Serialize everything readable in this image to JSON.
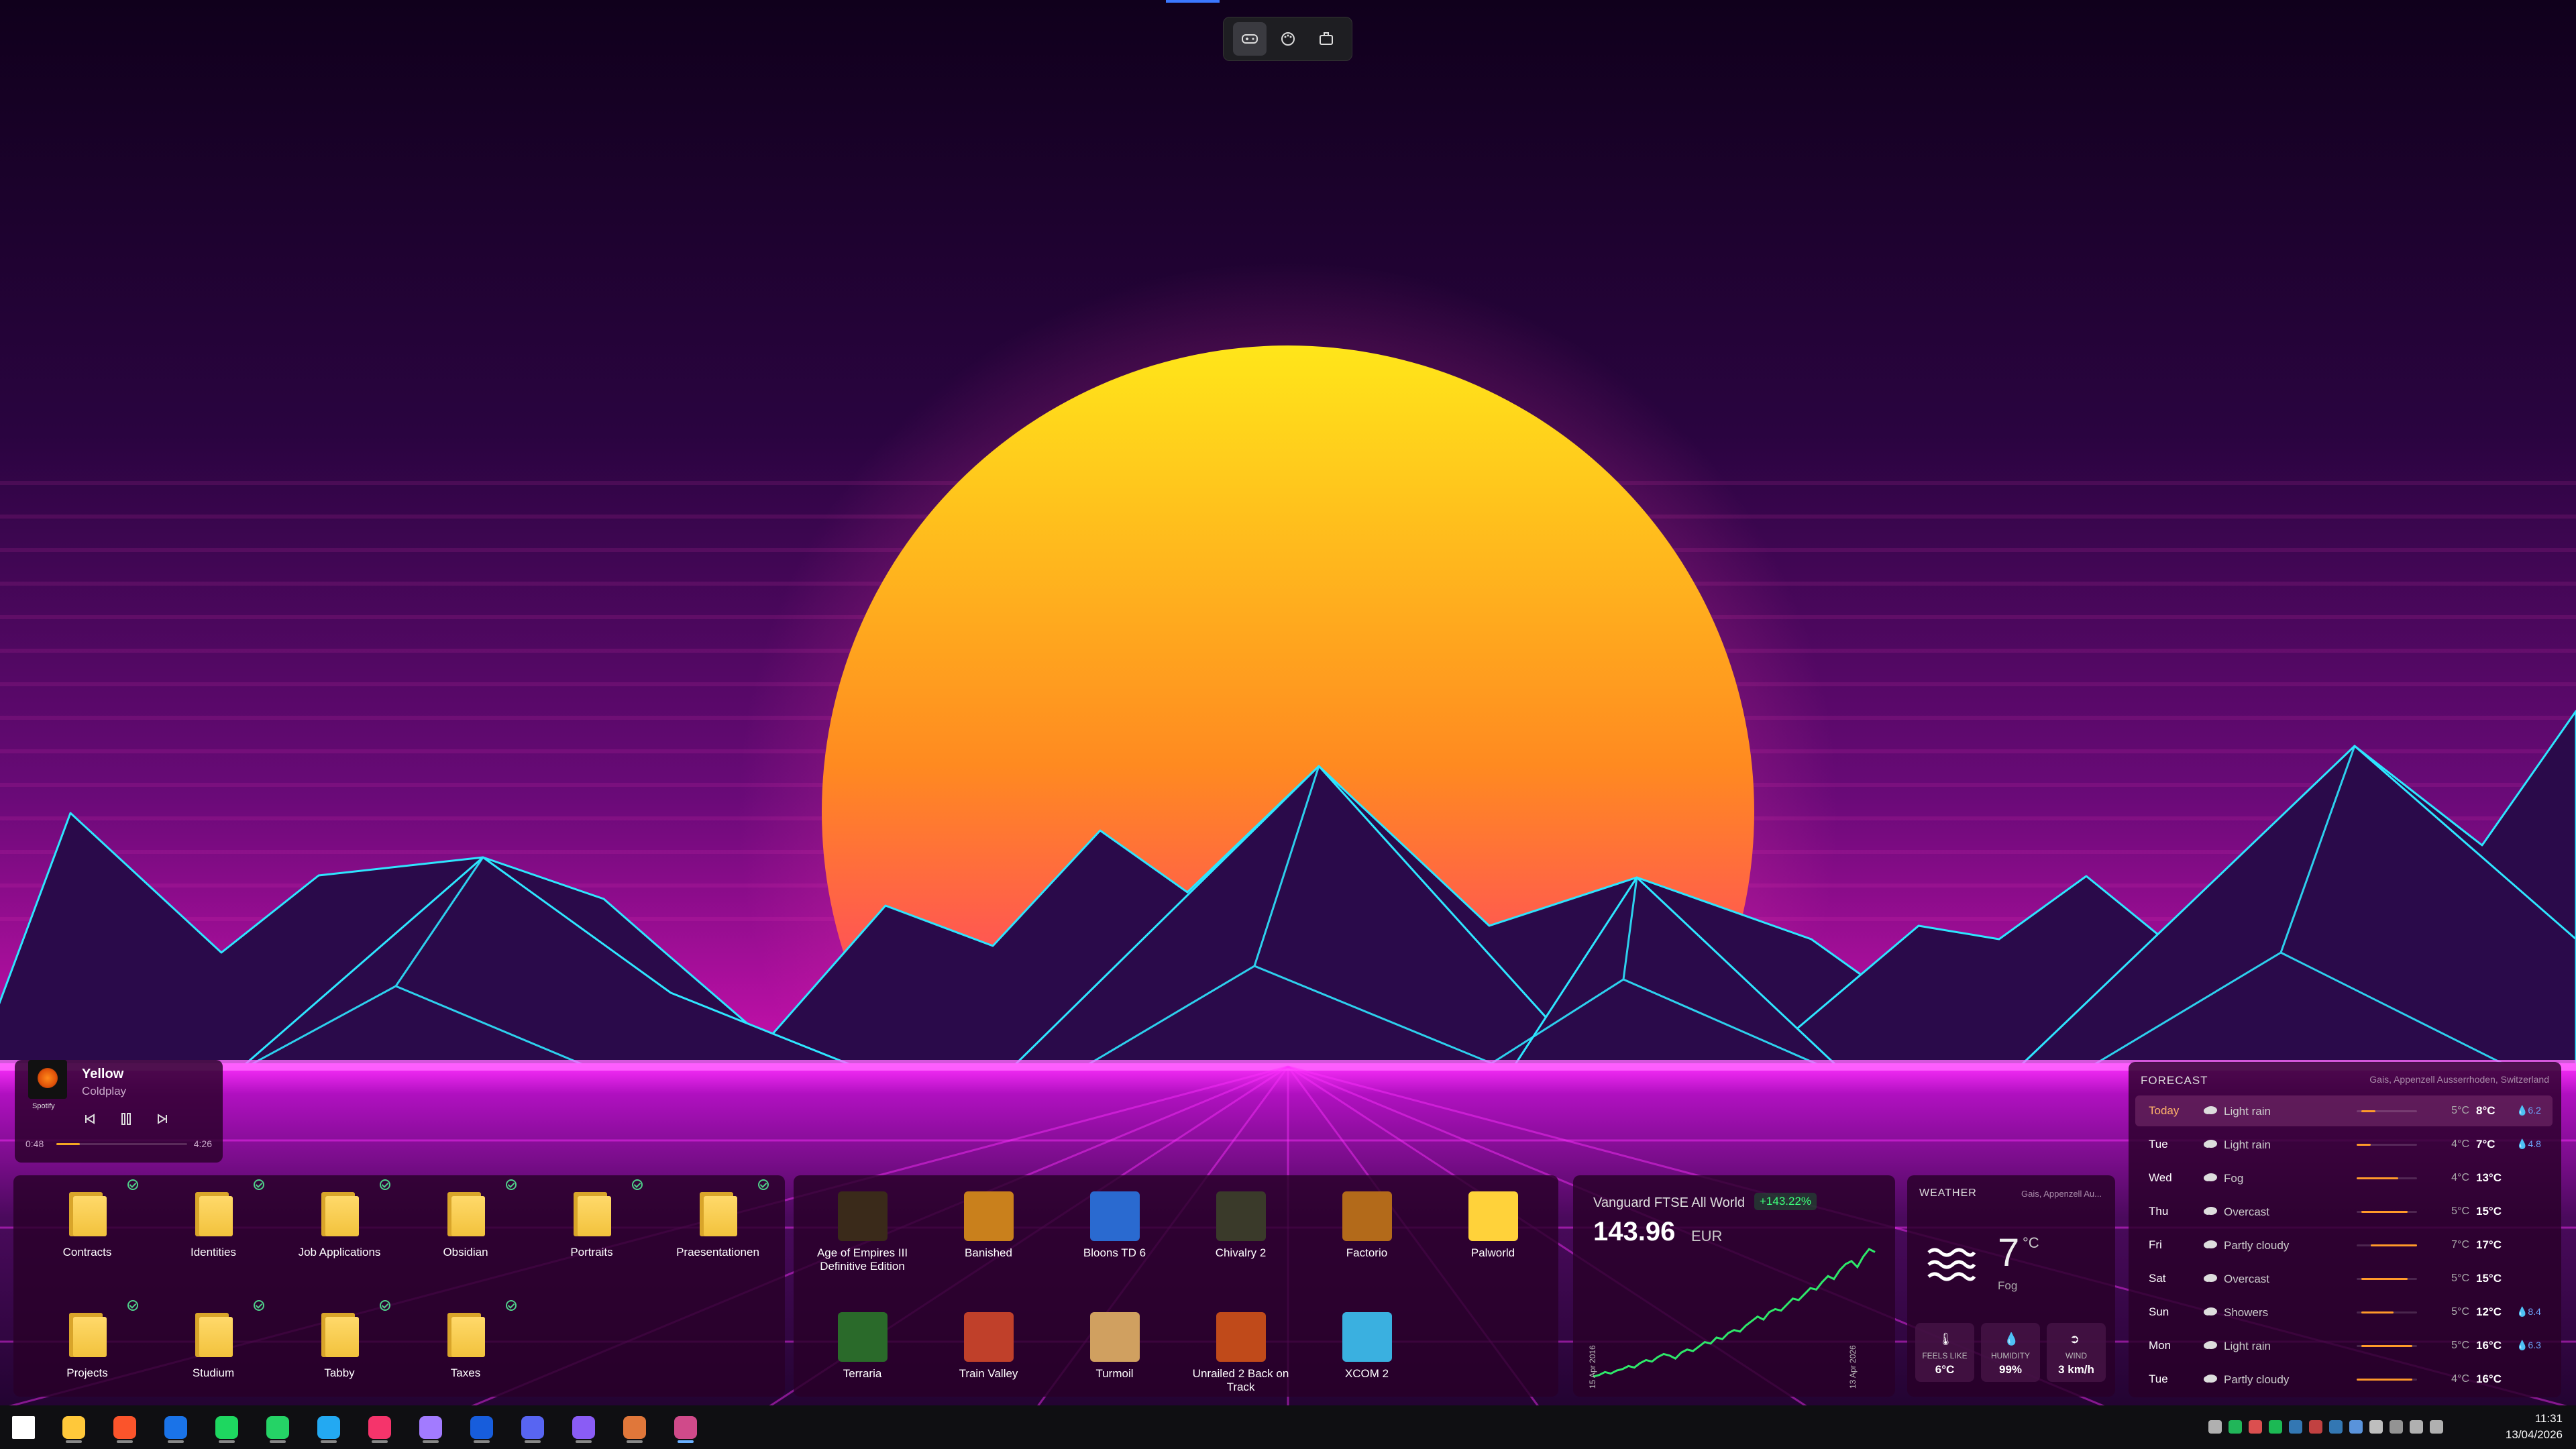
{
  "toolbar": {
    "buttons": [
      {
        "name": "games-tab-icon",
        "active": true
      },
      {
        "name": "palette-icon",
        "active": false
      },
      {
        "name": "briefcase-icon",
        "active": false
      }
    ]
  },
  "media": {
    "title": "Yellow",
    "artist": "Coldplay",
    "source": "Spotify",
    "elapsed": "0:48",
    "duration": "4:26",
    "progress": 0.18
  },
  "folders": [
    {
      "label": "Contracts",
      "synced": true
    },
    {
      "label": "Identities",
      "synced": true
    },
    {
      "label": "Job Applications",
      "synced": true
    },
    {
      "label": "Obsidian",
      "synced": true
    },
    {
      "label": "Portraits",
      "synced": true
    },
    {
      "label": "Praesentationen",
      "synced": true
    },
    {
      "label": "Projects",
      "synced": true
    },
    {
      "label": "Studium",
      "synced": true
    },
    {
      "label": "Tabby",
      "synced": true
    },
    {
      "label": "Taxes",
      "synced": true
    }
  ],
  "games": [
    {
      "label": "Age of Empires III Definitive Edition",
      "icon": "aoe-icon",
      "color": "#3a2a1a"
    },
    {
      "label": "Banished",
      "icon": "banished-icon",
      "color": "#c9801c"
    },
    {
      "label": "Bloons TD 6",
      "icon": "bloons-icon",
      "color": "#2a6ad0"
    },
    {
      "label": "Chivalry 2",
      "icon": "chivalry-icon",
      "color": "#3a3a2a"
    },
    {
      "label": "Factorio",
      "icon": "factorio-icon",
      "color": "#b36a1a"
    },
    {
      "label": "Palworld",
      "icon": "palworld-icon",
      "color": "#ffd23a"
    },
    {
      "label": "Terraria",
      "icon": "terraria-icon",
      "color": "#2a6a2a"
    },
    {
      "label": "Train Valley",
      "icon": "train-valley-icon",
      "color": "#c0402a"
    },
    {
      "label": "Turmoil",
      "icon": "turmoil-icon",
      "color": "#d0a060"
    },
    {
      "label": "Unrailed 2 Back on Track",
      "icon": "unrailed-icon",
      "color": "#c04a1a"
    },
    {
      "label": "XCOM 2",
      "icon": "xcom-icon",
      "color": "#3ab0e0"
    }
  ],
  "stock": {
    "name": "Vanguard FTSE All World",
    "change": "+143.22%",
    "price": "143.96",
    "currency": "EUR",
    "date_start": "15 Apr 2016",
    "date_end": "13 Apr 2026",
    "series": [
      15,
      16,
      18,
      17,
      19,
      20,
      22,
      21,
      24,
      26,
      25,
      28,
      30,
      29,
      27,
      31,
      33,
      32,
      35,
      38,
      37,
      41,
      40,
      44,
      46,
      45,
      49,
      52,
      55,
      53,
      58,
      60,
      59,
      63,
      67,
      66,
      70,
      74,
      73,
      78,
      82,
      80,
      86,
      90,
      92,
      88,
      95,
      100,
      98
    ]
  },
  "weather": {
    "header": "WEATHER",
    "location": "Gais, Appenzell Au...",
    "temp": "7",
    "unit": "°C",
    "condition": "Fog",
    "feels_label": "FEELS LIKE",
    "feels": "6°C",
    "humidity_label": "HUMIDITY",
    "humidity": "99%",
    "wind_label": "WIND",
    "wind": "3 km/h"
  },
  "forecast": {
    "header": "FORECAST",
    "location": "Gais, Appenzell Ausserrhoden, Switzerland",
    "days": [
      {
        "day": "Today",
        "cond": "Light rain",
        "lo": "5°C",
        "hi": "8°C",
        "precip": "6.2",
        "lo_n": 5,
        "hi_n": 8
      },
      {
        "day": "Tue",
        "cond": "Light rain",
        "lo": "4°C",
        "hi": "7°C",
        "precip": "4.8",
        "lo_n": 4,
        "hi_n": 7
      },
      {
        "day": "Wed",
        "cond": "Fog",
        "lo": "4°C",
        "hi": "13°C",
        "precip": "",
        "lo_n": 4,
        "hi_n": 13
      },
      {
        "day": "Thu",
        "cond": "Overcast",
        "lo": "5°C",
        "hi": "15°C",
        "precip": "",
        "lo_n": 5,
        "hi_n": 15
      },
      {
        "day": "Fri",
        "cond": "Partly cloudy",
        "lo": "7°C",
        "hi": "17°C",
        "precip": "",
        "lo_n": 7,
        "hi_n": 17
      },
      {
        "day": "Sat",
        "cond": "Overcast",
        "lo": "5°C",
        "hi": "15°C",
        "precip": "",
        "lo_n": 5,
        "hi_n": 15
      },
      {
        "day": "Sun",
        "cond": "Showers",
        "lo": "5°C",
        "hi": "12°C",
        "precip": "8.4",
        "lo_n": 5,
        "hi_n": 12
      },
      {
        "day": "Mon",
        "cond": "Light rain",
        "lo": "5°C",
        "hi": "16°C",
        "precip": "6.3",
        "lo_n": 5,
        "hi_n": 16
      },
      {
        "day": "Tue",
        "cond": "Partly cloudy",
        "lo": "4°C",
        "hi": "16°C",
        "precip": "",
        "lo_n": 4,
        "hi_n": 16
      }
    ]
  },
  "taskbar": {
    "apps": [
      {
        "name": "start-icon",
        "color": "#ffffff"
      },
      {
        "name": "file-explorer-icon",
        "color": "#ffc83a"
      },
      {
        "name": "brave-icon",
        "color": "#fb542b"
      },
      {
        "name": "outlook-icon",
        "color": "#1a73e8"
      },
      {
        "name": "spotify-icon",
        "color": "#1ed760"
      },
      {
        "name": "whatsapp-icon",
        "color": "#25d366"
      },
      {
        "name": "vscode-icon",
        "color": "#23a9f2"
      },
      {
        "name": "jetbrains-icon",
        "color": "#f5346b"
      },
      {
        "name": "github-icon",
        "color": "#a27bff"
      },
      {
        "name": "bitwarden-icon",
        "color": "#175ddc"
      },
      {
        "name": "discord-icon",
        "color": "#5865f2"
      },
      {
        "name": "obsidian-icon",
        "color": "#8a5cf5"
      },
      {
        "name": "claude-icon",
        "color": "#e0773a"
      },
      {
        "name": "app-icon",
        "color": "#d04a8a"
      }
    ],
    "time": "11:31",
    "date": "13/04/2026"
  }
}
